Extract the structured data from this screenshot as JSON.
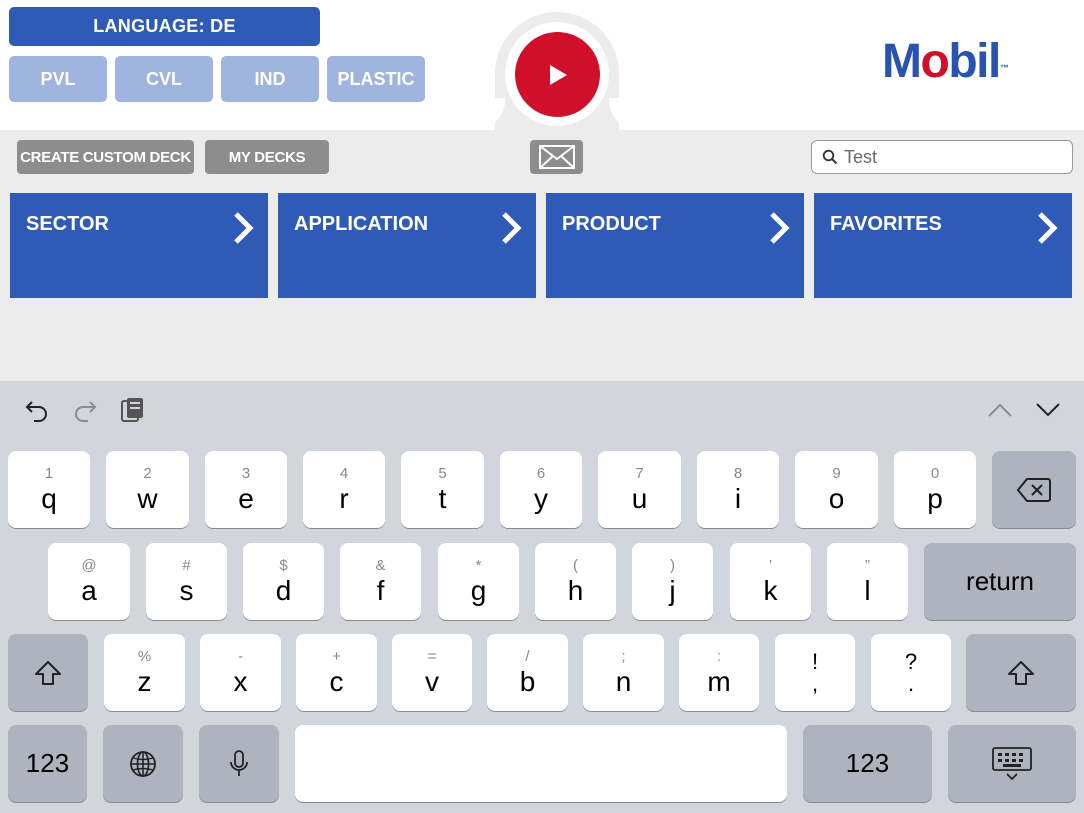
{
  "header": {
    "language_label": "LANGUAGE: DE",
    "segments": [
      "PVL",
      "CVL",
      "IND",
      "PLASTIC"
    ],
    "logo": {
      "prefix": "M",
      "o": "o",
      "suffix": "bil",
      "tm": "™"
    },
    "colors": {
      "brand_blue": "#2f5bb7",
      "light_blue": "#9fb4df",
      "brand_red": "#d0102b"
    }
  },
  "toolbar": {
    "create_label": "CREATE CUSTOM DECK",
    "mydecks_label": "MY DECKS",
    "mail_icon": "envelope-icon",
    "search_value": "Test",
    "search_icon": "search-icon"
  },
  "tiles": [
    {
      "label": "SECTOR"
    },
    {
      "label": "APPLICATION"
    },
    {
      "label": "PRODUCT"
    },
    {
      "label": "FAVORITES"
    }
  ],
  "keyboard": {
    "toolbar_icons": [
      "undo-icon",
      "redo-icon",
      "paste-icon",
      "chevron-up-icon",
      "chevron-down-icon"
    ],
    "row1": [
      {
        "hint": "1",
        "key": "q"
      },
      {
        "hint": "2",
        "key": "w"
      },
      {
        "hint": "3",
        "key": "e"
      },
      {
        "hint": "4",
        "key": "r"
      },
      {
        "hint": "5",
        "key": "t"
      },
      {
        "hint": "6",
        "key": "y"
      },
      {
        "hint": "7",
        "key": "u"
      },
      {
        "hint": "8",
        "key": "i"
      },
      {
        "hint": "9",
        "key": "o"
      },
      {
        "hint": "0",
        "key": "p"
      }
    ],
    "row2": [
      {
        "hint": "@",
        "key": "a"
      },
      {
        "hint": "#",
        "key": "s"
      },
      {
        "hint": "$",
        "key": "d"
      },
      {
        "hint": "&",
        "key": "f"
      },
      {
        "hint": "*",
        "key": "g"
      },
      {
        "hint": "(",
        "key": "h"
      },
      {
        "hint": ")",
        "key": "j"
      },
      {
        "hint": "’",
        "key": "k"
      },
      {
        "hint": "”",
        "key": "l"
      }
    ],
    "row3": [
      {
        "hint": "%",
        "key": "z"
      },
      {
        "hint": "-",
        "key": "x"
      },
      {
        "hint": "+",
        "key": "c"
      },
      {
        "hint": "=",
        "key": "v"
      },
      {
        "hint": "/",
        "key": "b"
      },
      {
        "hint": ";",
        "key": "n"
      },
      {
        "hint": ":",
        "key": "m"
      },
      {
        "hint": "!",
        "key": ","
      },
      {
        "hint": "?",
        "key": "."
      }
    ],
    "return_label": "return",
    "numbers_label": "123"
  }
}
